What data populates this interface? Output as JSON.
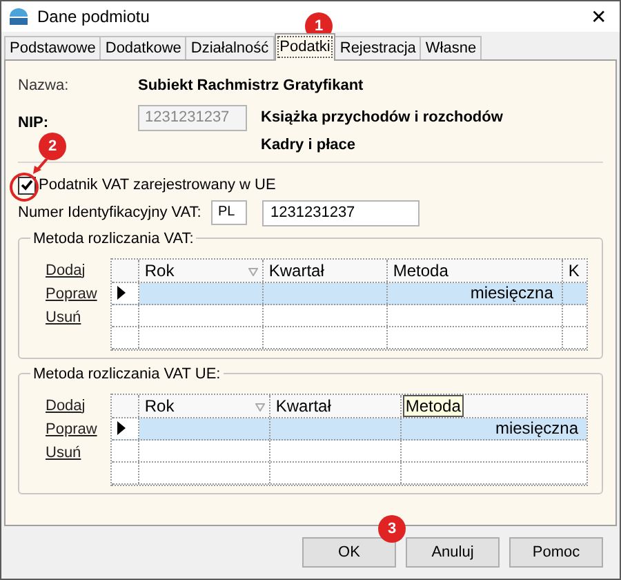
{
  "window": {
    "title": "Dane podmiotu",
    "close": "✕"
  },
  "tabs": [
    {
      "label": "Podstawowe",
      "selected": false
    },
    {
      "label": "Dodatkowe",
      "selected": false
    },
    {
      "label": "Działalność",
      "selected": false
    },
    {
      "label": "Podatki",
      "selected": true
    },
    {
      "label": "Rejestracja",
      "selected": false
    },
    {
      "label": "Własne",
      "selected": false
    }
  ],
  "entity": {
    "name_label": "Nazwa:",
    "name": "Subiekt Rachmistrz Gratyfikant",
    "nip_label": "NIP:",
    "nip": "1231231237",
    "modules": [
      "Książka przychodów i rozchodów",
      "Kadry i płace"
    ]
  },
  "eu_vat": {
    "label": "Podatnik VAT zarejestrowany w UE",
    "checked": true,
    "id_label": "Numer Identyfikacyjny VAT:",
    "country": "PL",
    "number": "1231231237"
  },
  "groups": [
    {
      "title": "Metoda rozliczania VAT:",
      "links": [
        "Dodaj",
        "Popraw",
        "Usuń"
      ],
      "columns": [
        {
          "label": "Rok",
          "sort": true
        },
        {
          "label": "Kwartał",
          "sort": false
        },
        {
          "label": "Metoda",
          "sort": false
        },
        {
          "label": "K",
          "sort": false
        }
      ],
      "rows": [
        {
          "cells": [
            "",
            "",
            "miesięczna",
            ""
          ],
          "selected": true
        },
        {
          "cells": [
            "",
            "",
            "",
            ""
          ],
          "selected": false
        },
        {
          "cells": [
            "",
            "",
            "",
            ""
          ],
          "selected": false
        }
      ]
    },
    {
      "title": "Metoda rozliczania VAT UE:",
      "links": [
        "Dodaj",
        "Popraw",
        "Usuń"
      ],
      "columns": [
        {
          "label": "Rok",
          "sort": true
        },
        {
          "label": "Kwartał",
          "sort": false
        },
        {
          "label": "Metoda",
          "sort": false,
          "tooltip": true
        }
      ],
      "rows": [
        {
          "cells": [
            "",
            "",
            "miesięczna"
          ],
          "selected": true
        },
        {
          "cells": [
            "",
            "",
            ""
          ],
          "selected": false
        },
        {
          "cells": [
            "",
            "",
            ""
          ],
          "selected": false
        }
      ]
    }
  ],
  "buttons": [
    "OK",
    "Anuluj",
    "Pomoc"
  ],
  "annotations": [
    "1",
    "2",
    "3"
  ]
}
